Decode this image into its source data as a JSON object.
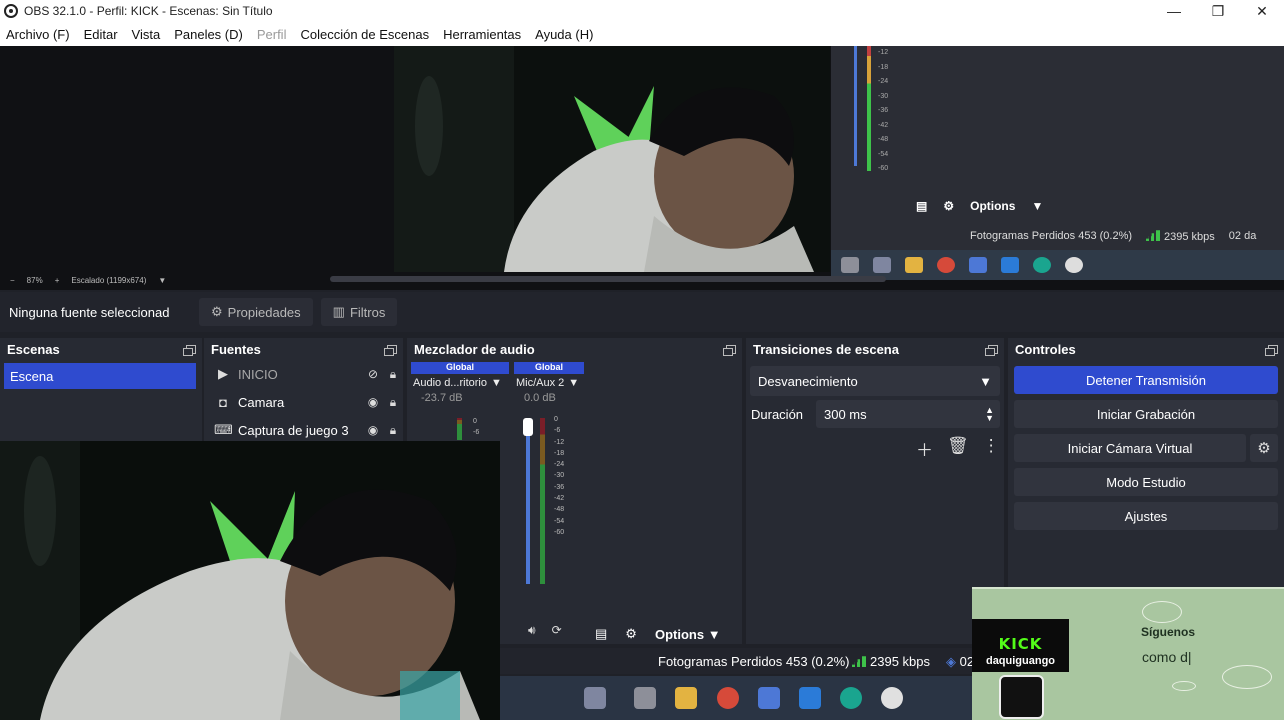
{
  "window": {
    "title": "OBS 32.1.0 - Perfil: KICK - Escenas: Sin Título",
    "minimize": "—",
    "maximize": "❐",
    "close": "✕"
  },
  "menu": [
    "Archivo (F)",
    "Editar",
    "Vista",
    "Paneles (D)",
    "Perfil",
    "Colección de Escenas",
    "Herramientas",
    "Ayuda (H)"
  ],
  "preview": {
    "zoom": "87%",
    "scaling": "Escalado (1199x674)",
    "overlay_options_label": "Options",
    "overlay_frames": "Fotogramas Perdidos 453 (0.2%)",
    "overlay_kbps": "2395 kbps",
    "overlay_extra": "02 da",
    "meter_ticks": [
      "-12",
      "-18",
      "-24",
      "-30",
      "-36",
      "-42",
      "-48",
      "-54",
      "-60"
    ]
  },
  "source_toolbar": {
    "no_source": "Ninguna fuente seleccionad",
    "properties": "Propiedades",
    "filters": "Filtros"
  },
  "scenes": {
    "title": "Escenas",
    "items": [
      "Escena"
    ]
  },
  "sources": {
    "title": "Fuentes",
    "items": [
      {
        "name": "INICIO",
        "icon": "play-icon",
        "visible": false
      },
      {
        "name": "Camara",
        "icon": "camera-icon",
        "visible": true
      },
      {
        "name": "Captura de juego 3",
        "icon": "gamepad-icon",
        "visible": true
      }
    ]
  },
  "mixer": {
    "title": "Mezclador de audio",
    "channels": [
      {
        "tag": "Global",
        "name": "Audio d...ritorio",
        "db": "-23.7 dB",
        "level": 0.0
      },
      {
        "tag": "Global",
        "name": "Mic/Aux 2",
        "db": "0.0 dB",
        "level": 0.7
      }
    ],
    "ticks": [
      "0",
      "-6",
      "-12",
      "-18",
      "-24",
      "-30",
      "-36",
      "-42",
      "-48",
      "-54",
      "-60"
    ],
    "options_label": "Options"
  },
  "transitions": {
    "title": "Transiciones de escena",
    "selected": "Desvanecimiento",
    "duration_label": "Duración",
    "duration_value": "300 ms"
  },
  "controls": {
    "title": "Controles",
    "stop_stream": "Detener Transmisión",
    "start_record": "Iniciar Grabación",
    "start_virtual_cam": "Iniciar Cámara Virtual",
    "studio_mode": "Modo Estudio",
    "settings": "Ajustes"
  },
  "statusbar": {
    "dropped_frames": "Fotogramas Perdidos 453 (0.2%)",
    "bitrate": "2395 kbps",
    "extra": "02"
  },
  "kick_overlay": {
    "logo": "KICK",
    "username": "daquiguango",
    "follow": "Síguenos",
    "subtext": "como d|"
  },
  "colors": {
    "accent_blue": "#2f4bcf",
    "panel_bg": "#272a33",
    "kick_green": "#53fc18",
    "meter_green": "#3ec24a"
  }
}
